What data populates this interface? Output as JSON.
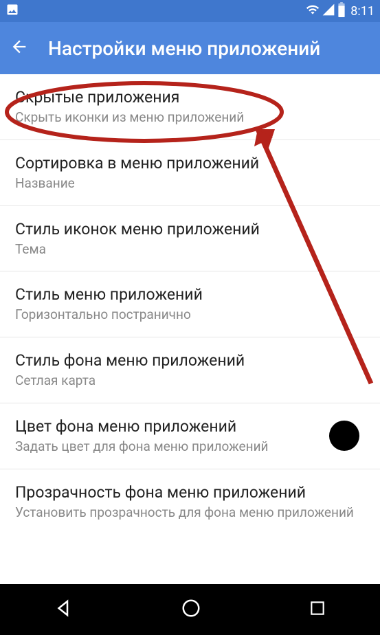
{
  "status": {
    "time": "8:11"
  },
  "header": {
    "title": "Настройки меню приложений"
  },
  "items": [
    {
      "title": "Скрытые приложения",
      "subtitle": "Скрыть иконки из меню приложений"
    },
    {
      "title": "Сортировка в меню приложений",
      "subtitle": "Название"
    },
    {
      "title": "Стиль иконок меню приложений",
      "subtitle": "Тема"
    },
    {
      "title": "Стиль меню приложений",
      "subtitle": "Горизонтально постранично"
    },
    {
      "title": "Стиль фона меню приложений",
      "subtitle": "Сетлая карта"
    },
    {
      "title": "Цвет фона меню приложений",
      "subtitle": "Задать цвет для фона меню приложений",
      "color": "#000000"
    },
    {
      "title": "Прозрачность фона меню приложений",
      "subtitle": "Установить прозрачность для фона меню приложений"
    }
  ]
}
